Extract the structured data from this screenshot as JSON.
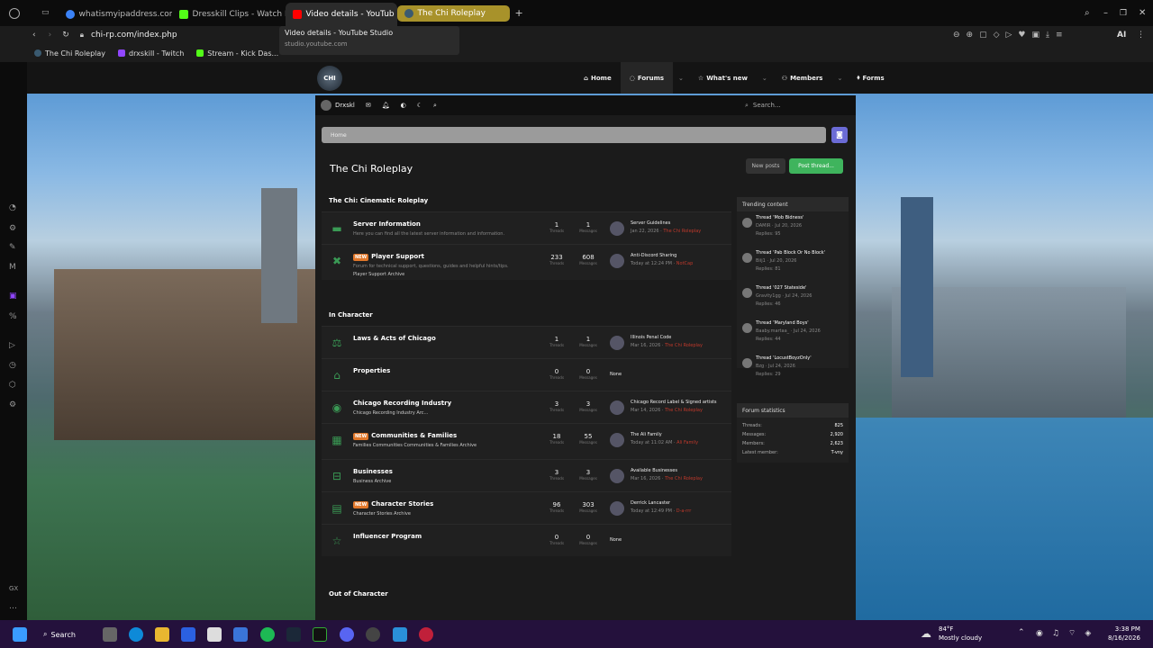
{
  "browser": {
    "tabs": [
      {
        "title": "whatismyipaddress.com",
        "color": "#3b82f6"
      },
      {
        "title": "Dresskill Clips - Watch Liv",
        "color": "#53fc18"
      },
      {
        "title": "Video details - YouTub",
        "color": "#ff0000",
        "active": true
      },
      {
        "title": "The Chi Roleplay",
        "color": "#a8922a"
      }
    ],
    "new_tab": "+",
    "url": "chi-rp.com/index.php",
    "tooltip_title": "Video details - YouTube Studio",
    "tooltip_domain": "studio.youtube.com",
    "bookmarks": [
      "The Chi Roleplay",
      "drxskill - Twitch",
      "Stream - Kick Das..."
    ],
    "ai_label": "AI"
  },
  "site": {
    "logo": "CHI",
    "nav": [
      "Home",
      "Forums",
      "What's new",
      "Members",
      "Forms"
    ],
    "user": "Drxskl",
    "search_placeholder": "Search...",
    "breadcrumb": "Home",
    "page_title": "The Chi Roleplay",
    "new_posts": "New posts",
    "post_thread": "Post thread..."
  },
  "sections": [
    {
      "title": "The Chi: Cinematic Roleplay",
      "nodes": [
        {
          "name": "Server Information",
          "desc": "Here you can find all the latest server information and information.",
          "threads": "1",
          "messages": "1",
          "latest": "Server Guidelines",
          "meta": "Jan 22, 2026 ·",
          "by": "The Chi Roleplay"
        },
        {
          "name": "Player Support",
          "new": "NEW",
          "desc": "Forum for technical support, questions, guides and helpful hints/tips.",
          "sub": "Player Support Archive",
          "threads": "233",
          "messages": "608",
          "latest": "Anti-Discord Sharing",
          "meta": "Today at 12:24 PM ·",
          "by": "NotCap"
        }
      ]
    },
    {
      "title": "In Character",
      "nodes": [
        {
          "name": "Laws & Acts of Chicago",
          "threads": "1",
          "messages": "1",
          "latest": "Illinois Penal Code",
          "meta": "Mar 16, 2026 ·",
          "by": "The Chi Roleplay"
        },
        {
          "name": "Properties",
          "threads": "0",
          "messages": "0",
          "latest": "None"
        },
        {
          "name": "Chicago Recording Industry",
          "sub": "Chicago Recording Industry Arc...",
          "threads": "3",
          "messages": "3",
          "latest": "Chicago Record Label & Signed artists",
          "meta": "Mar 14, 2026 ·",
          "by": "The Chi Roleplay"
        },
        {
          "name": "Communities & Families",
          "new": "NEW",
          "sub": "Families   Communities   Communities & Families Archive",
          "threads": "18",
          "messages": "55",
          "latest": "The Ali Family",
          "meta": "Today at 11:02 AM ·",
          "by": "Ali Family"
        },
        {
          "name": "Businesses",
          "sub": "Business Archive",
          "threads": "3",
          "messages": "3",
          "latest": "Available Businesses",
          "meta": "Mar 16, 2026 ·",
          "by": "The Chi Roleplay"
        },
        {
          "name": "Character Stories",
          "new": "NEW",
          "sub": "Character Stories Archive",
          "threads": "96",
          "messages": "303",
          "latest": "Derrick Lancaster",
          "meta": "Today at 12:49 PM ·",
          "by": "D-a-rrr"
        },
        {
          "name": "Influencer Program",
          "threads": "0",
          "messages": "0",
          "latest": "None"
        }
      ]
    },
    {
      "title": "Out of Character",
      "nodes": []
    }
  ],
  "col_labels": {
    "threads": "Threads",
    "messages": "Messages"
  },
  "trending": {
    "title": "Trending content",
    "items": [
      {
        "title": "Thread 'Mob Bidness'",
        "meta": "DAMIR · Jul 20, 2026",
        "replies": "Replies: 95"
      },
      {
        "title": "Thread 'Pab Block Or No Block'",
        "meta": "Biij1 · Jul 20, 2026",
        "replies": "Replies: 81"
      },
      {
        "title": "Thread '027 Stateside'",
        "meta": "Gravity1gg · Jul 24, 2026",
        "replies": "Replies: 46"
      },
      {
        "title": "Thread 'Maryland Boys'",
        "meta": "Baaby.martaa_ · Jul 24, 2026",
        "replies": "Replies: 44"
      },
      {
        "title": "Thread 'LocustBoyzOnly'",
        "meta": "Bzg · Jul 24, 2026",
        "replies": "Replies: 29"
      }
    ]
  },
  "stats": {
    "title": "Forum statistics",
    "rows": [
      {
        "label": "Threads:",
        "value": "825"
      },
      {
        "label": "Messages:",
        "value": "2,920"
      },
      {
        "label": "Members:",
        "value": "2,623"
      },
      {
        "label": "Latest member:",
        "value": "T-vny"
      }
    ]
  },
  "taskbar": {
    "search": "Search",
    "weather_temp": "84°F",
    "weather_desc": "Mostly cloudy",
    "time": "3:38 PM",
    "date": "8/16/2026"
  }
}
